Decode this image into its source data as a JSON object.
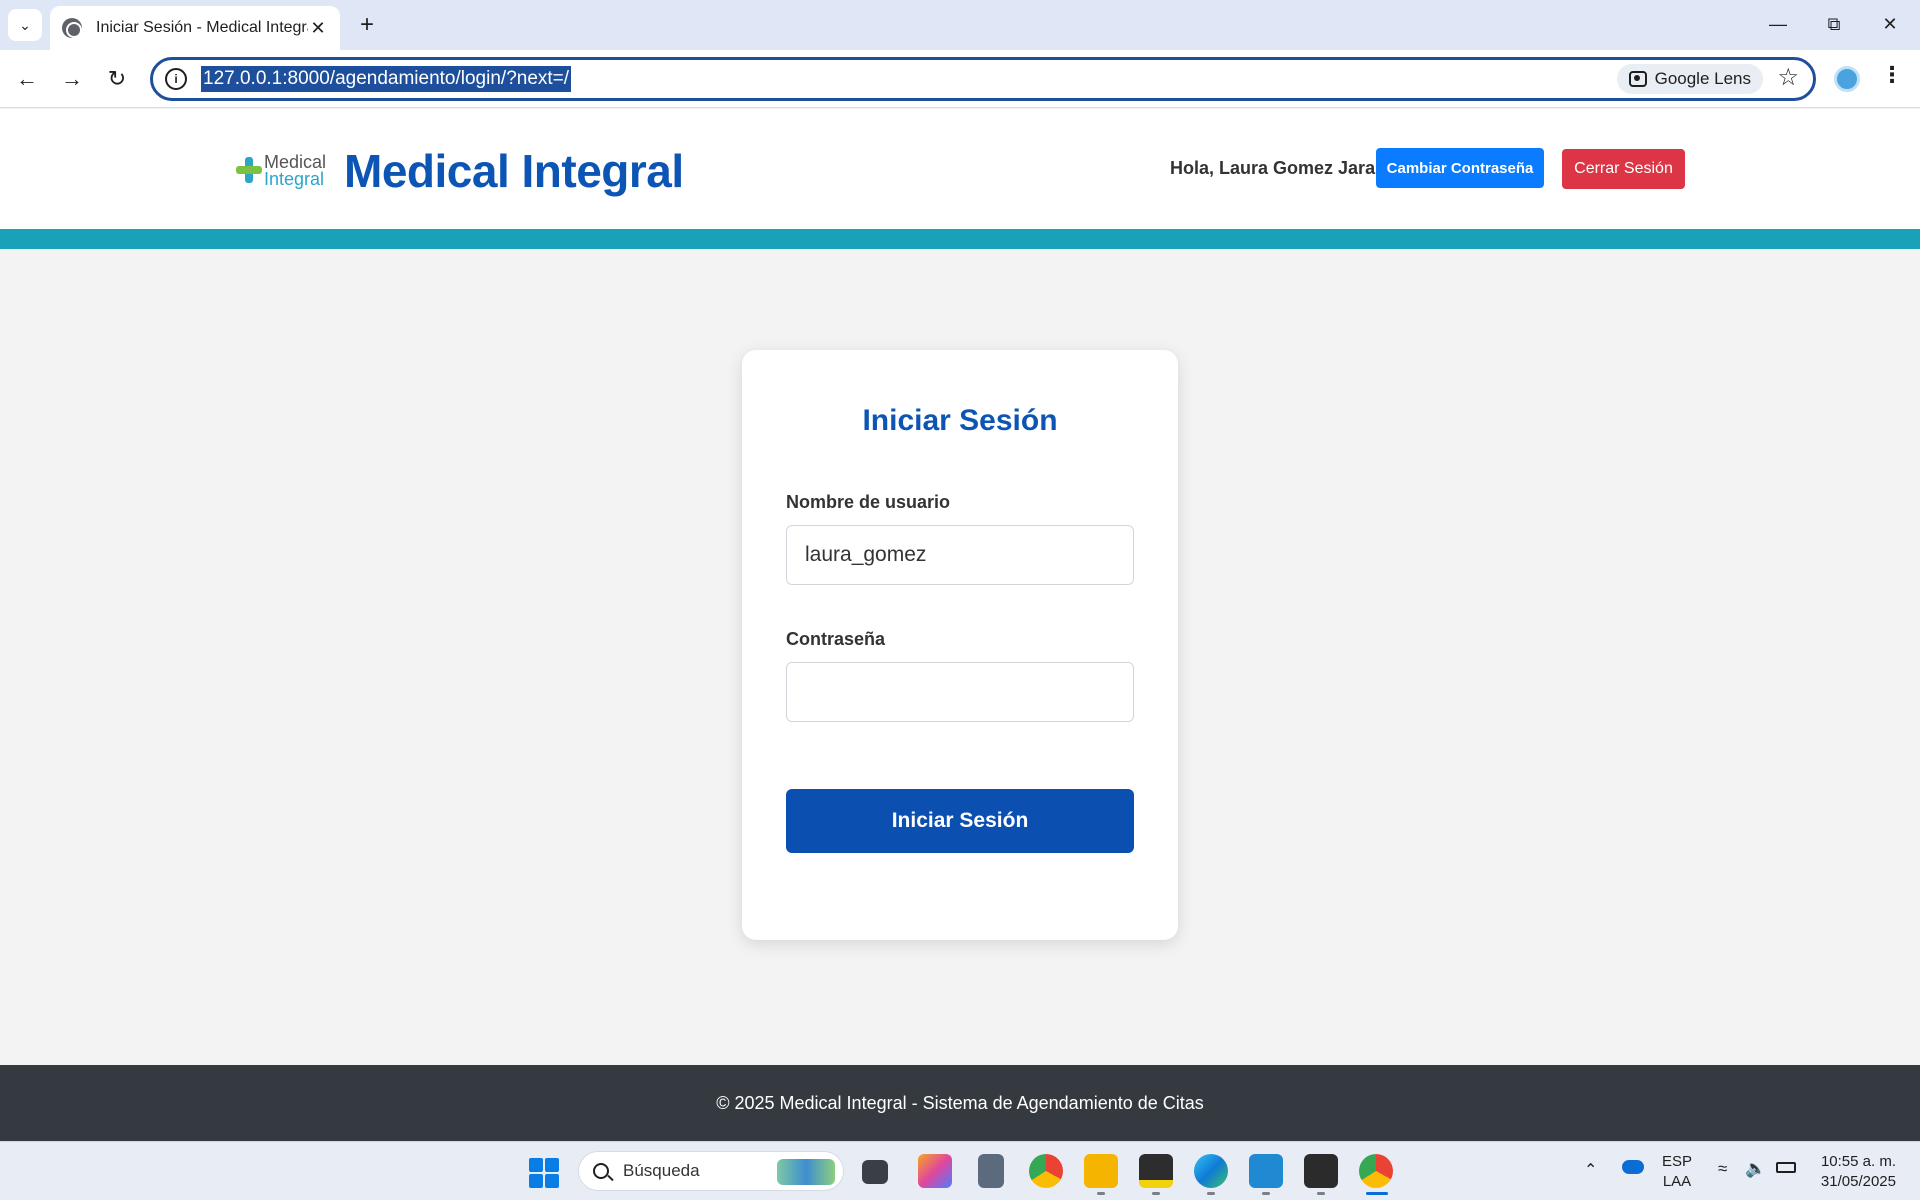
{
  "browser": {
    "tab_title": "Iniciar Sesión - Medical Integral",
    "url": "127.0.0.1:8000/agendamiento/login/?next=/",
    "lens_label": "Google Lens"
  },
  "header": {
    "logo_line1": "Medical",
    "logo_line2": "Integral",
    "site_title": "Medical Integral",
    "greeting": "Hola, Laura Gomez Jara",
    "change_password_label": "Cambiar Contraseña",
    "logout_label": "Cerrar Sesión"
  },
  "login": {
    "title": "Iniciar Sesión",
    "username_label": "Nombre de usuario",
    "username_value": "laura_gomez",
    "password_label": "Contraseña",
    "password_value": "",
    "submit_label": "Iniciar Sesión"
  },
  "footer": {
    "text": "© 2025 Medical Integral - Sistema de Agendamiento de Citas"
  },
  "taskbar": {
    "search_placeholder": "Búsqueda",
    "lang_line1": "ESP",
    "lang_line2": "LAA",
    "time": "10:55 a. m.",
    "date": "31/05/2025"
  },
  "colors": {
    "brand_blue": "#0d55b4",
    "accent_teal": "#17a2b8",
    "primary_button": "#0b7bff",
    "danger_button": "#dc3545",
    "footer_bg": "#343a40"
  }
}
